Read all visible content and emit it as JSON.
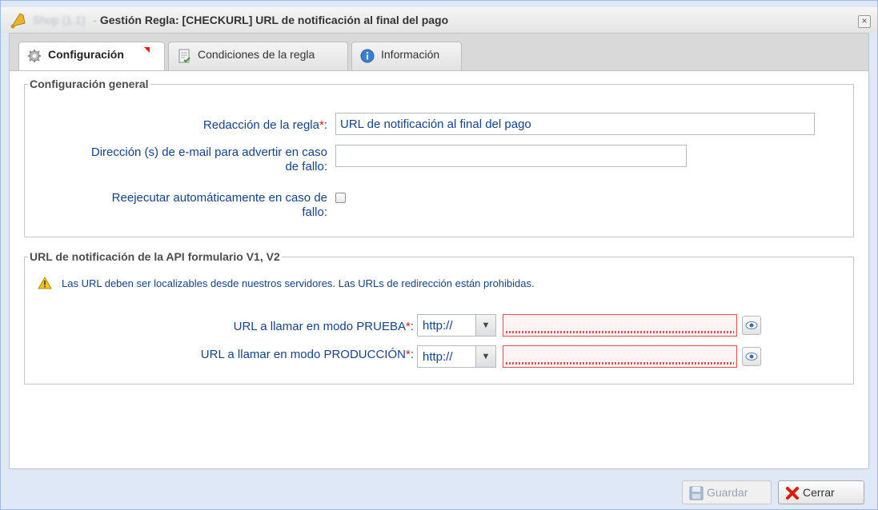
{
  "window": {
    "title_prefix": "Shop (1.1)",
    "title_separator": " - ",
    "title": "Gestión Regla: [CHECKURL] URL de notificación al final del pago",
    "close_glyph": "×"
  },
  "tabs": [
    {
      "label": "Configuración",
      "icon": "gear-icon",
      "active": true
    },
    {
      "label": "Condiciones de la regla",
      "icon": "document-icon",
      "active": false
    },
    {
      "label": "Información",
      "icon": "info-icon",
      "active": false
    }
  ],
  "general": {
    "legend": "Configuración general",
    "rule_label": "Redacción de la regla",
    "rule_value": "URL de notificación al final del pago",
    "email_label_line1": "Dirección (s) de e-mail para advertir en caso",
    "email_label_line2": "de fallo:",
    "email_value": "",
    "retry_label_line1": "Reejecutar automáticamente en caso de",
    "retry_label_line2": "fallo:",
    "retry_checked": false
  },
  "api": {
    "legend": "URL de notificación de la API formulario V1, V2",
    "warning": "Las URL deben ser localizables desde nuestros servidores. Las URLs de redirección están prohibidas.",
    "test_label": "URL a llamar en modo PRUEBA",
    "prod_label": "URL a llamar en modo PRODUCCIÓN",
    "test_protocol": "http://",
    "prod_protocol": "http://",
    "test_url": "",
    "prod_url": ""
  },
  "common": {
    "required_mark": "*",
    "colon": ":"
  },
  "footer": {
    "save_label": "Guardar",
    "close_label": "Cerrar"
  },
  "colors": {
    "label_blue": "#15428b",
    "required_red": "#d81e05",
    "invalid_border": "#e94c4c",
    "background": "#dfe8f6"
  }
}
